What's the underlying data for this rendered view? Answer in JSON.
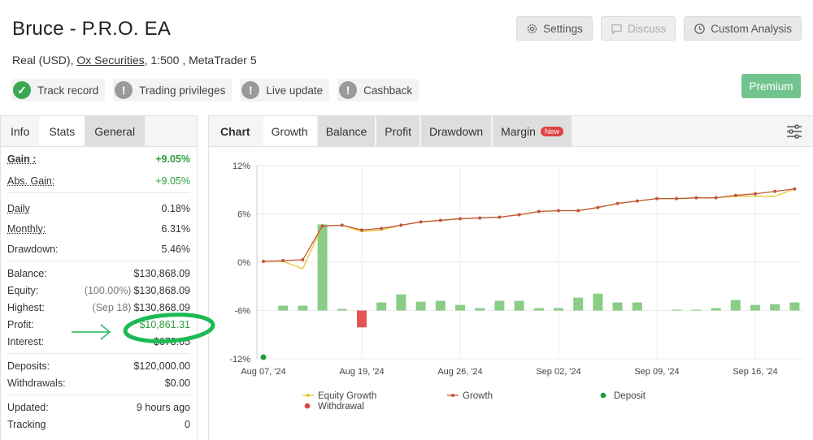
{
  "header": {
    "title": "Bruce - P.R.O. EA",
    "account_type": "Real (USD),",
    "broker": "Ox Securities",
    "leverage_platform": ", 1:500 , MetaTrader 5"
  },
  "top_buttons": {
    "settings": "Settings",
    "discuss": "Discuss",
    "custom_analysis": "Custom Analysis"
  },
  "badges": {
    "track_record": "Track record",
    "trading_privileges": "Trading privileges",
    "live_update": "Live update",
    "cashback": "Cashback"
  },
  "premium": "Premium",
  "left_tabs": {
    "info": "Info",
    "stats": "Stats",
    "general": "General"
  },
  "stats": {
    "gain_label": "Gain :",
    "gain_value": "+9.05%",
    "abs_gain_label": "Abs. Gain:",
    "abs_gain_value": "+9.05%",
    "daily_label": "Daily",
    "daily_value": "0.18%",
    "monthly_label": "Monthly:",
    "monthly_value": "6.31%",
    "drawdown_label": "Drawdown:",
    "drawdown_value": "5.46%",
    "balance_label": "Balance:",
    "balance_value": "$130,868.09",
    "equity_label": "Equity:",
    "equity_pre": "(100.00%)",
    "equity_value": "$130,868.09",
    "highest_label": "Highest:",
    "highest_pre": "(Sep 18)",
    "highest_value": "$130,868.09",
    "profit_label": "Profit:",
    "profit_value": "$10,861.31",
    "interest_label": "Interest:",
    "interest_value": "$673.05",
    "deposits_label": "Deposits:",
    "deposits_value": "$120,000.00",
    "withdrawals_label": "Withdrawals:",
    "withdrawals_value": "$0.00",
    "updated_label": "Updated:",
    "updated_value": "9 hours ago",
    "tracking_label": "Tracking",
    "tracking_value": "0"
  },
  "right_tabs": {
    "chart": "Chart",
    "growth": "Growth",
    "balance": "Balance",
    "profit": "Profit",
    "drawdown": "Drawdown",
    "margin": "Margin",
    "new_tag": "New"
  },
  "colors": {
    "equity": "#e8c430",
    "growth": "#c0573a",
    "bar_pos": "#7cc87a",
    "bar_neg": "#e04242",
    "deposit": "#1a9e3a",
    "annotation": "#1db954"
  },
  "chart_data": {
    "type": "line",
    "title": "",
    "xlabel": "",
    "ylabel": "",
    "ylim": [
      -12,
      12
    ],
    "yticks": [
      "12%",
      "6%",
      "0%",
      "-6%",
      "-12%"
    ],
    "xtick_labels": [
      "Aug 07, '24",
      "Aug 19, '24",
      "Aug 26, '24",
      "Sep 02, '24",
      "Sep 09, '24",
      "Sep 16, '24"
    ],
    "x": [
      0,
      1,
      2,
      3,
      4,
      5,
      6,
      7,
      8,
      9,
      10,
      11,
      12,
      13,
      14,
      15,
      16,
      17,
      18,
      19,
      20,
      21,
      22,
      23,
      24,
      25,
      26,
      27
    ],
    "series": [
      {
        "name": "Growth",
        "values": [
          0.1,
          0.2,
          0.3,
          4.5,
          4.6,
          4.0,
          4.2,
          4.6,
          5.0,
          5.2,
          5.4,
          5.5,
          5.6,
          5.9,
          6.3,
          6.4,
          6.4,
          6.8,
          7.3,
          7.6,
          7.9,
          7.9,
          8.0,
          8.0,
          8.3,
          8.5,
          8.8,
          9.1
        ]
      },
      {
        "name": "Equity Growth",
        "values": [
          0.1,
          0.1,
          -0.8,
          4.5,
          4.6,
          3.8,
          4.0,
          4.6,
          5.0,
          5.2,
          5.4,
          5.5,
          5.6,
          5.9,
          6.3,
          6.4,
          6.4,
          6.8,
          7.3,
          7.6,
          7.9,
          7.9,
          8.0,
          8.0,
          8.2,
          8.2,
          8.2,
          9.1
        ]
      },
      {
        "name": "Withdrawal",
        "values": [
          null,
          0.6,
          0.6,
          10.7,
          0.2,
          -2.1,
          1.0,
          2.0,
          1.1,
          1.2,
          0.7,
          0.3,
          1.2,
          1.2,
          0.3,
          0.3,
          1.6,
          2.1,
          1.0,
          1.0,
          0.0,
          0.1,
          0.1,
          0.3,
          1.3,
          0.7,
          0.8,
          1.0
        ]
      },
      {
        "name": "Deposit",
        "values": [
          -11.9
        ]
      }
    ],
    "legend": [
      "Equity Growth",
      "Growth",
      "Deposit",
      "Withdrawal"
    ],
    "legend_position": "bottom",
    "grid": true
  }
}
